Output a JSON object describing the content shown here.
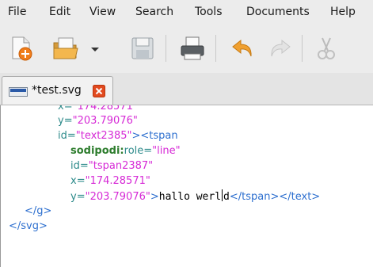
{
  "menu": {
    "file": "File",
    "edit": "Edit",
    "view": "View",
    "search": "Search",
    "tools": "Tools",
    "documents": "Documents",
    "help": "Help"
  },
  "toolbar": {
    "buttons": [
      "new-document-icon",
      "open-icon",
      "open-dropdown-icon",
      "save-icon",
      "print-icon",
      "undo-icon",
      "redo-icon",
      "cut-icon"
    ],
    "colors": {
      "orange": "#f0a030",
      "blue_gray": "#8a9aa8",
      "disabled": "#c8c8c8"
    }
  },
  "tab": {
    "label": "*test.svg",
    "close_color": "#e24a1f"
  },
  "code": {
    "l1_attr": "x=",
    "l1_val": "\"174.28571\"",
    "l2_attr": "y=",
    "l2_val": "\"203.79076\"",
    "l3_attr": "id=",
    "l3_val": "\"text2385\"",
    "l3_tag": "><tspan",
    "l4_ns": "sodipodi:",
    "l4_attr": "role=",
    "l4_val": "\"line\"",
    "l5_attr": "id=",
    "l5_val": "\"tspan2387\"",
    "l6_attr": "x=",
    "l6_val": "\"174.28571\"",
    "l7_attr": "y=",
    "l7_val": "\"203.79076\"",
    "l7_gt": ">",
    "l7_text_a": "hallo werl",
    "l7_text_b": "d",
    "l7_close": "</tspan></text>",
    "l8": "</g>",
    "l9": "</svg>"
  }
}
